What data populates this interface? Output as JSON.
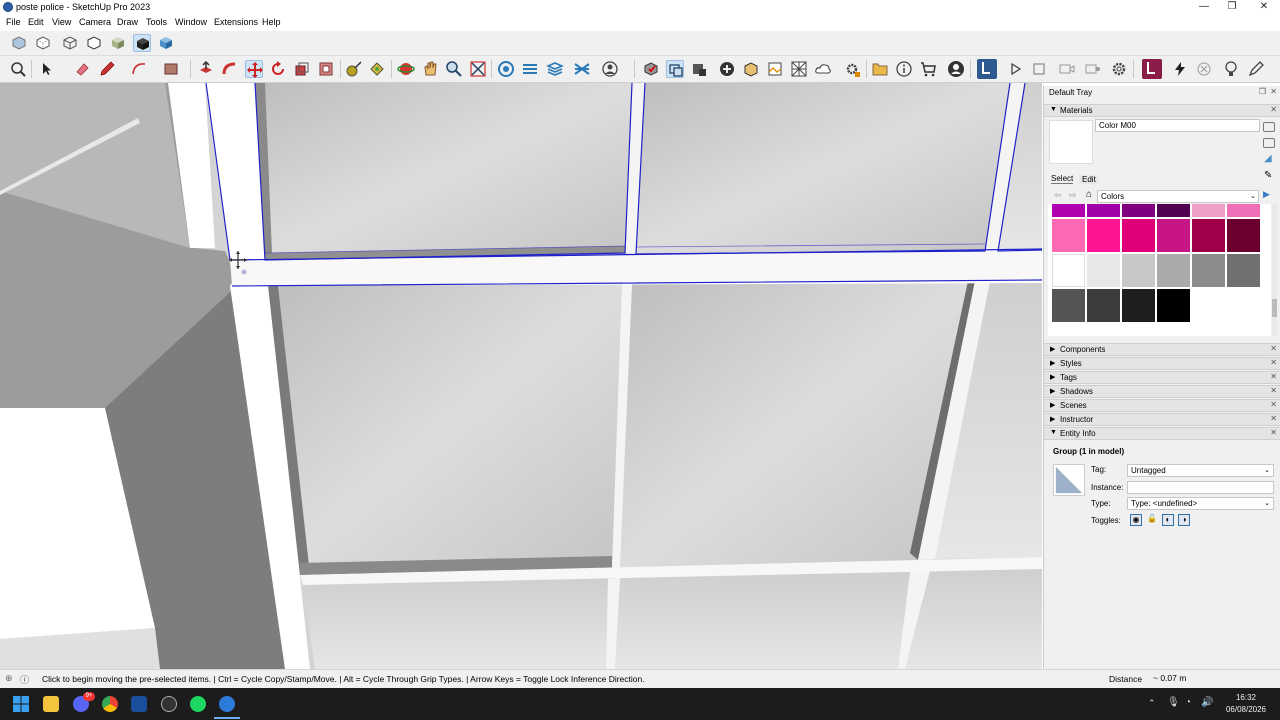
{
  "window": {
    "title": "poste police - SketchUp Pro 2023",
    "minimize_glyph": "—",
    "maximize_glyph": "❐",
    "close_glyph": "✕"
  },
  "menu": [
    "File",
    "Edit",
    "View",
    "Camera",
    "Draw",
    "Tools",
    "Window",
    "Extensions",
    "Help"
  ],
  "toolbar1": {
    "icons": [
      "xray-icon",
      "back-edges-icon",
      "wireframe-icon",
      "hidden-line-icon",
      "shaded-icon",
      "shaded-textures-icon",
      "monochrome-icon"
    ],
    "active": "shaded-textures-icon"
  },
  "toolbar2": {
    "icons": [
      "zoom-extents-icon",
      "select-icon",
      "eraser-icon",
      "pencil-icon",
      "arc-icon",
      "rectangle-icon",
      "push-pull-icon",
      "follow-me-icon",
      "move-icon",
      "rotate-icon",
      "scale-icon",
      "offset-icon",
      "tape-measure-icon",
      "paint-bucket-icon",
      "orbit-icon",
      "pan-icon",
      "zoom-icon",
      "zoom-window-icon",
      "sandbox-icon",
      "3d-warehouse-icon",
      "extension-warehouse-icon",
      "model-info-icon",
      "layout-icon",
      "trimble-connect-icon",
      "add-location-icon",
      "geo-icon",
      "photo-match-icon",
      "texture-icon",
      "cloud-icon",
      "settings-icon",
      "camera-icon",
      "info-icon",
      "cart-icon",
      "account-icon",
      "profile-builder-icon",
      "play-icon",
      "stop-icon",
      "video-icon",
      "record-icon",
      "gear-icon",
      "extension-icon",
      "lightning-icon",
      "close-circle-icon",
      "bulb-icon",
      "pen-icon"
    ],
    "active": "move-icon"
  },
  "tray": {
    "title": "Default Tray",
    "materials": {
      "header": "Materials",
      "color_name": "Color M00",
      "tab_select": "Select",
      "tab_edit": "Edit",
      "library": "Colors",
      "swatches": [
        [
          "#b000b0",
          "#a000a8",
          "#800080",
          "#500050",
          "#f0a0c8",
          "#f070b8"
        ],
        [
          "#ff69b4",
          "#ff1493",
          "#e0007a",
          "#c71585",
          "#a0004a",
          "#6b0030"
        ],
        [
          "#ffffff",
          "#e8e8e8",
          "#c8c8c8",
          "#aaaaaa",
          "#8c8c8c",
          "#707070"
        ],
        [
          "#555555",
          "#3c3c3c",
          "#1e1e1e",
          "#000000"
        ]
      ]
    },
    "panels": [
      "Components",
      "Styles",
      "Tags",
      "Shadows",
      "Scenes",
      "Instructor",
      "Entity Info"
    ],
    "entity_info": {
      "title": "Group (1 in model)",
      "tag_label": "Tag:",
      "tag_value": "Untagged",
      "instance_label": "Instance:",
      "instance_value": "",
      "type_label": "Type:",
      "type_value": "Type: <undefined>",
      "toggles_label": "Toggles:"
    }
  },
  "status": {
    "message": "Click to begin moving the pre-selected items. | Ctrl = Cycle Copy/Stamp/Move. | Alt = Cycle Through Grip Types. | Arrow Keys = Toggle Lock Inference Direction.",
    "measure_label": "Distance",
    "measure_value": "~ 0.07 m"
  },
  "taskbar": {
    "apps": [
      "start-icon",
      "file-explorer-icon",
      "discord-icon",
      "chrome-icon",
      "steam-icon",
      "github-desktop-icon",
      "spotify-icon",
      "sketchup-icon"
    ],
    "notification_badge": "9+",
    "time": "16:32",
    "date": "06/08/2026"
  },
  "colors": {
    "selection": "#1f22c8",
    "viewport_bg": "#dcdcdc"
  }
}
